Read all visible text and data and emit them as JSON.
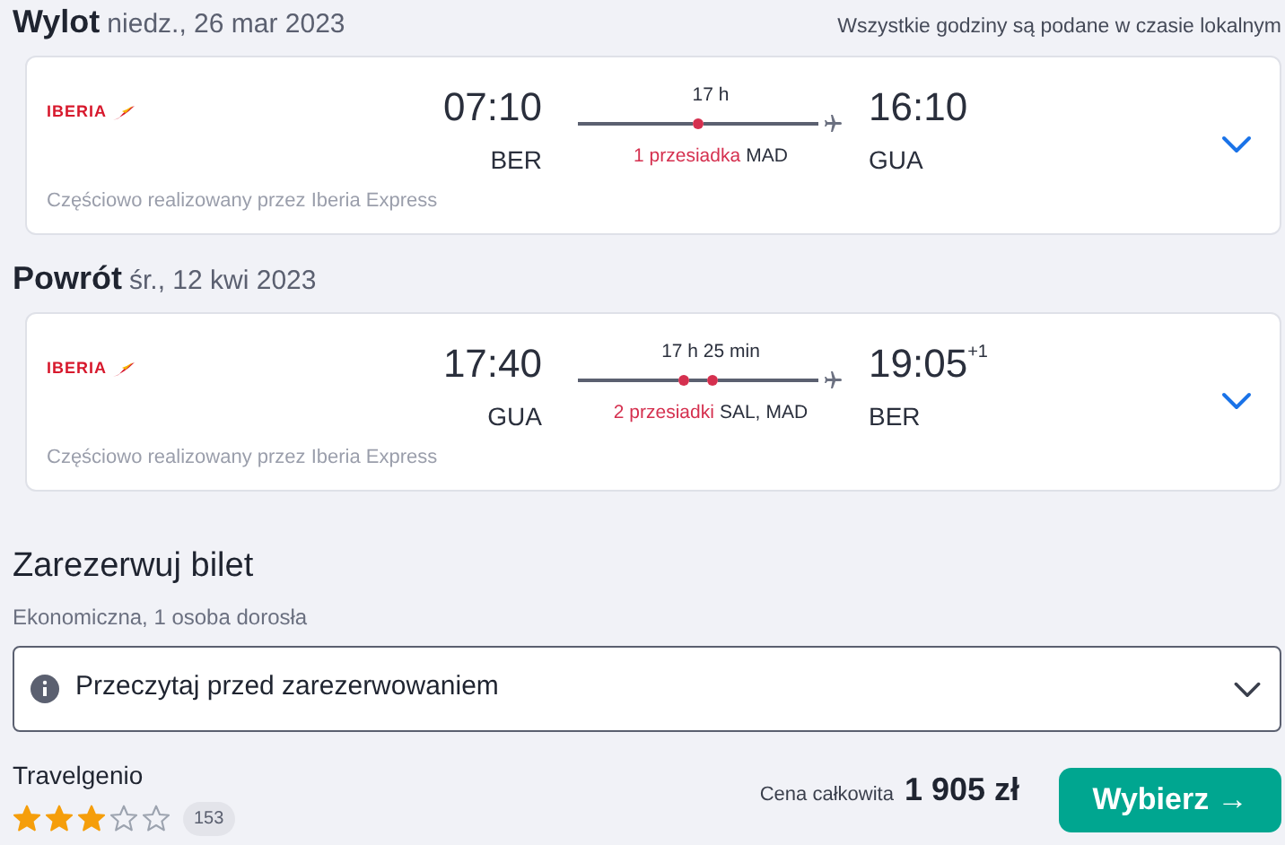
{
  "legs": [
    {
      "title": "Wylot",
      "date": "niedz., 26 mar 2023",
      "note": "Wszystkie godziny są podane w czasie lokalnym",
      "airline": "IBERIA",
      "depart_time": "07:10",
      "depart_code": "BER",
      "duration": "17 h",
      "arrive_time": "16:10",
      "arrive_code": "GUA",
      "stops_label": "1 przesiadka",
      "stops": [
        {
          "code": "MAD"
        }
      ],
      "operated_by": "Częściowo realizowany przez Iberia Express"
    },
    {
      "title": "Powrót",
      "date": "śr., 12 kwi 2023",
      "airline": "IBERIA",
      "depart_time": "17:40",
      "depart_code": "GUA",
      "duration": "17 h 25 min",
      "arrive_time": "19:05",
      "day_offset": "+1",
      "arrive_code": "BER",
      "stops_label": "2 przesiadki",
      "stops": [
        {
          "code": "SAL,"
        },
        {
          "code": "MAD"
        }
      ],
      "operated_by": "Częściowo realizowany przez Iberia Express"
    }
  ],
  "booking": {
    "title": "Zarezerwuj bilet",
    "subtitle": "Ekonomiczna, 1 osoba dorosła",
    "info": {
      "label": "Przeczytaj przed zarezerwowaniem",
      "expanded": false
    },
    "provider": "Travelgenio",
    "stars": 3,
    "reviews": "153",
    "price_label": "Cena całkowita",
    "price": "1 905 zł",
    "button": "Wybierz →"
  }
}
